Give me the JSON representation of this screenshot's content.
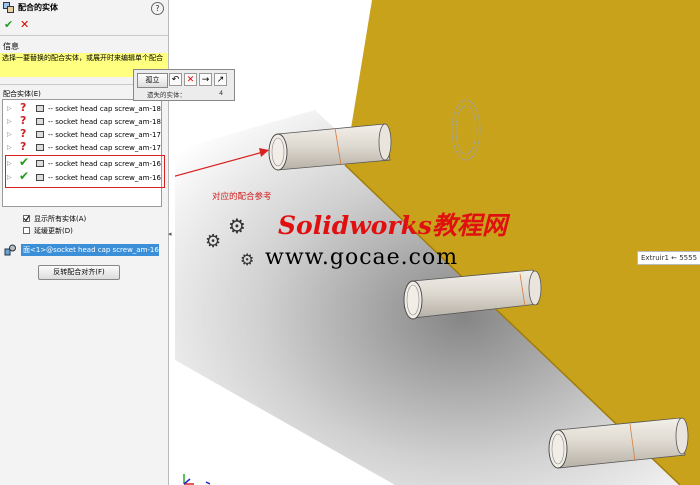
{
  "panel": {
    "title": "配合的实体",
    "help": "?",
    "ok_symbol": "✔",
    "cancel_symbol": "✕",
    "info_section_label": "信息",
    "info_message": "选择一要替换的配合实体，或展开时来编辑单个配合",
    "entities_section_label": "配合实体(E)",
    "entities": [
      {
        "status": "missing",
        "text": "-- socket head cap screw_am-18"
      },
      {
        "status": "missing",
        "text": "-- socket head cap screw_am-18"
      },
      {
        "status": "missing",
        "text": "-- socket head cap screw_am-17"
      },
      {
        "status": "missing",
        "text": "-- socket head cap screw_am-17"
      },
      {
        "status": "ok",
        "text": "-- socket head cap screw_am-16"
      },
      {
        "status": "ok",
        "text": "-- socket head cap screw_am-16"
      }
    ],
    "show_all_entities": {
      "label": "显示所有实体(A)",
      "checked": true
    },
    "defer_update": {
      "label": "延缓更新(D)",
      "checked": false
    },
    "mate_reference": "面<1>@socket head cap screw_am-16",
    "flip_alignment_button": "反转配合对齐(F)"
  },
  "popup": {
    "isolate_button": "孤立",
    "missing_entities_label": "遗失的实体：",
    "missing_entities_count": "4"
  },
  "viewport": {
    "annotation": "对应的配合参考",
    "watermark_title": "Solidworks教程网",
    "watermark_url": "www.gocae.com",
    "tooltip": "Extruir1 ← 5555"
  },
  "colors": {
    "plate": "#c9a21b",
    "selection": "#3a8fd8",
    "highlight": "#d92020",
    "info_bg": "#ffff80"
  }
}
